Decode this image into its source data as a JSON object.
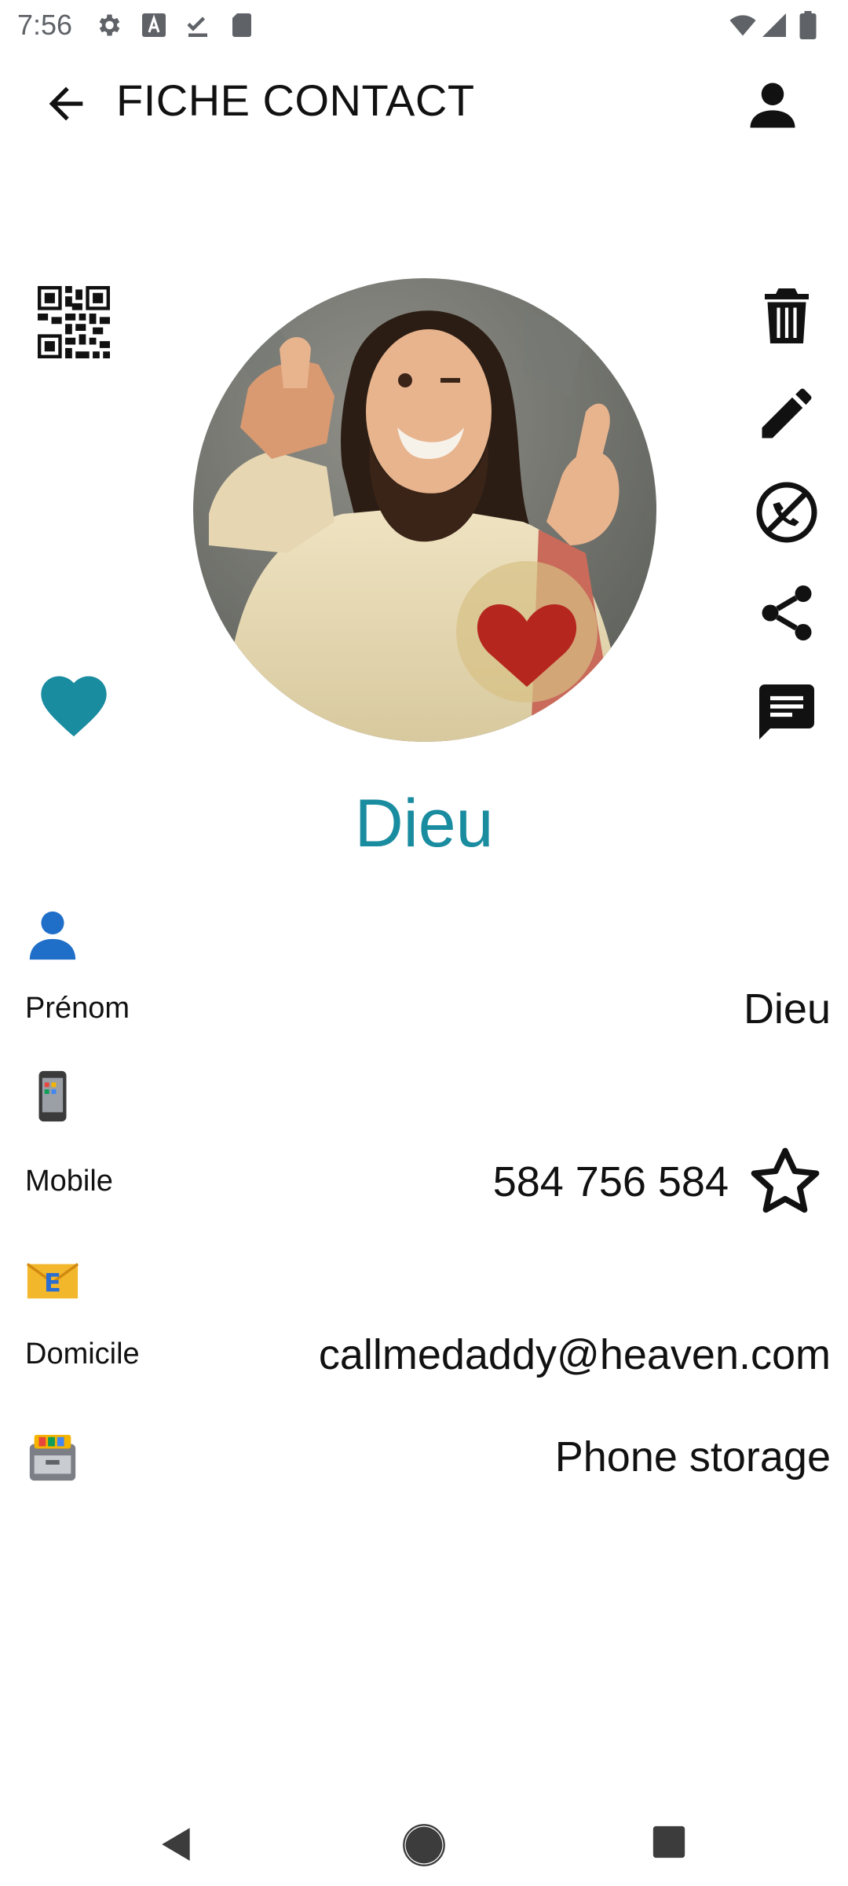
{
  "status_bar": {
    "time": "7:56",
    "left_icons": [
      "settings-icon",
      "text-a-icon",
      "download-done-icon",
      "sd-card-icon"
    ],
    "right_icons": [
      "wifi-icon",
      "signal-icon",
      "battery-icon"
    ]
  },
  "app_bar": {
    "back_icon": "arrow-back-icon",
    "title": "FICHE CONTACT",
    "account_icon": "person-icon"
  },
  "contact": {
    "name": "Dieu",
    "favorite_color": "#1a8ca0",
    "side_actions_left": [
      "qr-code-icon",
      "heart-icon"
    ],
    "side_actions_right": [
      "delete-icon",
      "edit-icon",
      "call-blocked-icon",
      "share-icon",
      "message-icon"
    ]
  },
  "fields": {
    "first_name": {
      "icon": "person-emoji-icon",
      "label": "Prénom",
      "value": "Dieu"
    },
    "mobile": {
      "icon": "mobile-phone-emoji-icon",
      "label": "Mobile",
      "value": "584 756 584",
      "star_icon": "star-outline-icon"
    },
    "email": {
      "icon": "email-emoji-icon",
      "label": "Domicile",
      "value": "callmedaddy@heaven.com"
    },
    "storage": {
      "icon": "file-cabinet-emoji-icon",
      "value": "Phone storage"
    }
  },
  "nav_bar": {
    "icons": [
      "back-triangle-icon",
      "home-circle-icon",
      "recents-square-icon"
    ]
  },
  "colors": {
    "accent": "#1a8ca0",
    "icon_dark": "#111111"
  }
}
